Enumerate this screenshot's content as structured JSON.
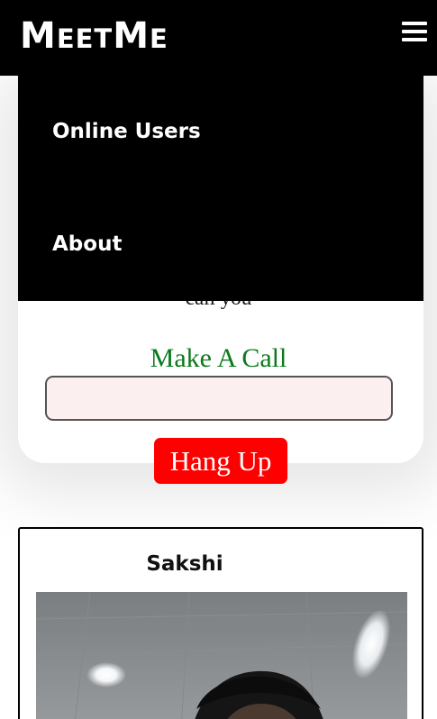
{
  "header": {
    "logo_prefix": "M",
    "logo_mid": "EET",
    "logo_prefix2": "M",
    "logo_suffix": "E"
  },
  "nav": {
    "items": [
      {
        "label": "Online Users"
      },
      {
        "label": "About"
      }
    ]
  },
  "call_panel": {
    "partial_text": "call you",
    "heading": "Make A Call",
    "input_value": "",
    "hangup_label": "Hang Up"
  },
  "user_card": {
    "name": "Sakshi"
  },
  "colors": {
    "header_bg": "#000000",
    "heading_green": "#0a7a1a",
    "hangup_red": "#ff0000",
    "input_bg": "#fbefef"
  },
  "icons": {
    "menu": "hamburger-menu-icon"
  }
}
